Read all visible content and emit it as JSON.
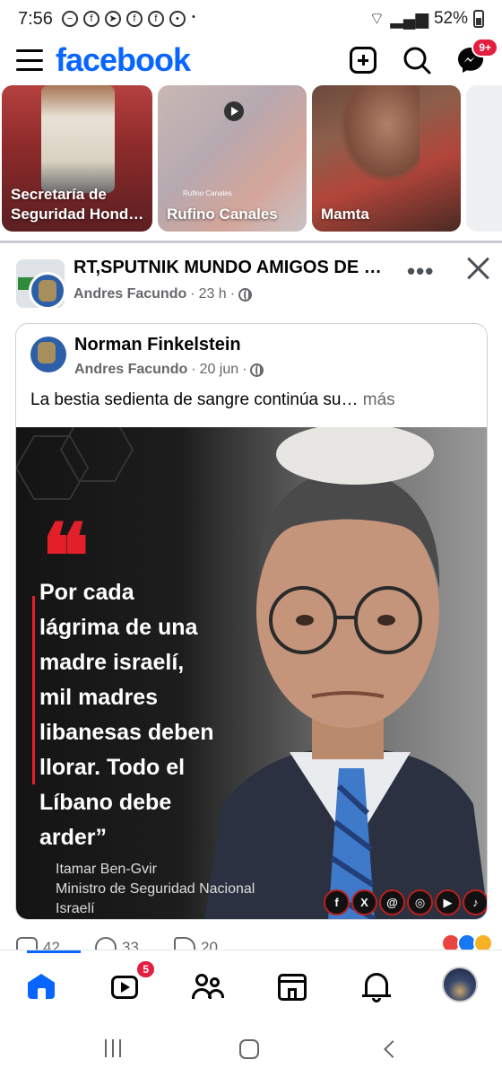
{
  "status_bar": {
    "time": "7:56",
    "battery": "52%"
  },
  "header": {
    "logo": "facebook",
    "messenger_badge": "9+",
    "accent": "#0866ff"
  },
  "stories": [
    {
      "label": "Secretaría de Seguridad Hond…"
    },
    {
      "label": "Rufino Canales",
      "sub": "Rufino Canales"
    },
    {
      "label": "Mamta"
    }
  ],
  "post": {
    "group_name": "RT,SPUTNIK MUNDO AMIGOS DE …",
    "author": "Andres Facundo",
    "time": "23 h",
    "more_icon": "•••"
  },
  "shared": {
    "name": "Norman Finkelstein",
    "author": "Andres Facundo",
    "date": "20 jun",
    "text": "La bestia sedienta de sangre continúa su…",
    "more_link": "más",
    "image": {
      "quote_mark": "❝",
      "quote": "Por cada\nlágrima de una\nmadre israelí,\nmil madres\nlibanesas deben\nllorar. Todo el\nLíbano debe\narder”",
      "author_line1": "Itamar Ben-Gvir",
      "author_line2": "Ministro de Seguridad Nacional",
      "author_line3": "Israelí",
      "quote_color": "#e3202a"
    }
  },
  "reactions": {
    "likes": "42",
    "comments": "33",
    "shares": "20"
  },
  "tabbar": {
    "video_badge": "5"
  }
}
